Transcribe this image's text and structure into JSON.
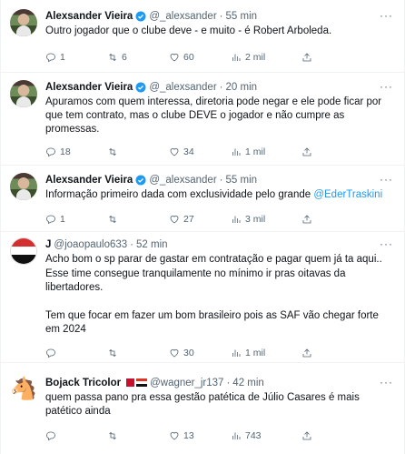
{
  "tweets": [
    {
      "author": "Alexsander Vieira",
      "handle": "@_alexsander",
      "time": "55 min",
      "verified": true,
      "text": [
        "Outro jogador que o clube deve - e muito - é Robert Arboleda."
      ],
      "mention": "",
      "replies": "1",
      "retweets": "6",
      "likes": "60",
      "views": "2 mil"
    },
    {
      "author": "Alexsander Vieira",
      "handle": "@_alexsander",
      "time": "20 min",
      "verified": true,
      "text": [
        "Apuramos com quem interessa, diretoria pode negar e ele pode ficar por que tem contrato, mas o clube DEVE o jogador e não cumpre as promessas."
      ],
      "mention": "",
      "replies": "18",
      "retweets": "",
      "likes": "34",
      "views": "1 mil"
    },
    {
      "author": "Alexsander Vieira",
      "handle": "@_alexsander",
      "time": "55 min",
      "verified": true,
      "text": [
        "Informação primeiro dada com exclusividade pelo grande "
      ],
      "mention": "@EderTraskini",
      "replies": "1",
      "retweets": "",
      "likes": "27",
      "views": "3 mil"
    },
    {
      "author": "J",
      "handle": "@joaopaulo633",
      "time": "52 min",
      "verified": false,
      "text": [
        "Acho bom o sp parar de gastar em contratação e pagar quem já ta aqui.. Esse time consegue tranquilamente no mínimo ir pras oitavas da libertadores.",
        "Tem que focar em fazer um bom brasileiro pois as SAF vão chegar forte em 2024"
      ],
      "mention": "",
      "replies": "",
      "retweets": "",
      "likes": "30",
      "views": "1 mil"
    },
    {
      "author": "Bojack Tricolor",
      "handle": "@wagner_jr137",
      "time": "42 min",
      "verified": false,
      "text": [
        "quem passa pano pra essa gestão patética de  Júlio Casares é mais patético ainda"
      ],
      "mention": "",
      "replies": "",
      "retweets": "",
      "likes": "13",
      "views": "743"
    }
  ],
  "ui": {
    "dot": "·",
    "more": "···"
  },
  "colors": {
    "link": "#1d9bf0",
    "muted": "#536471",
    "verified": "#1d9bf0"
  }
}
